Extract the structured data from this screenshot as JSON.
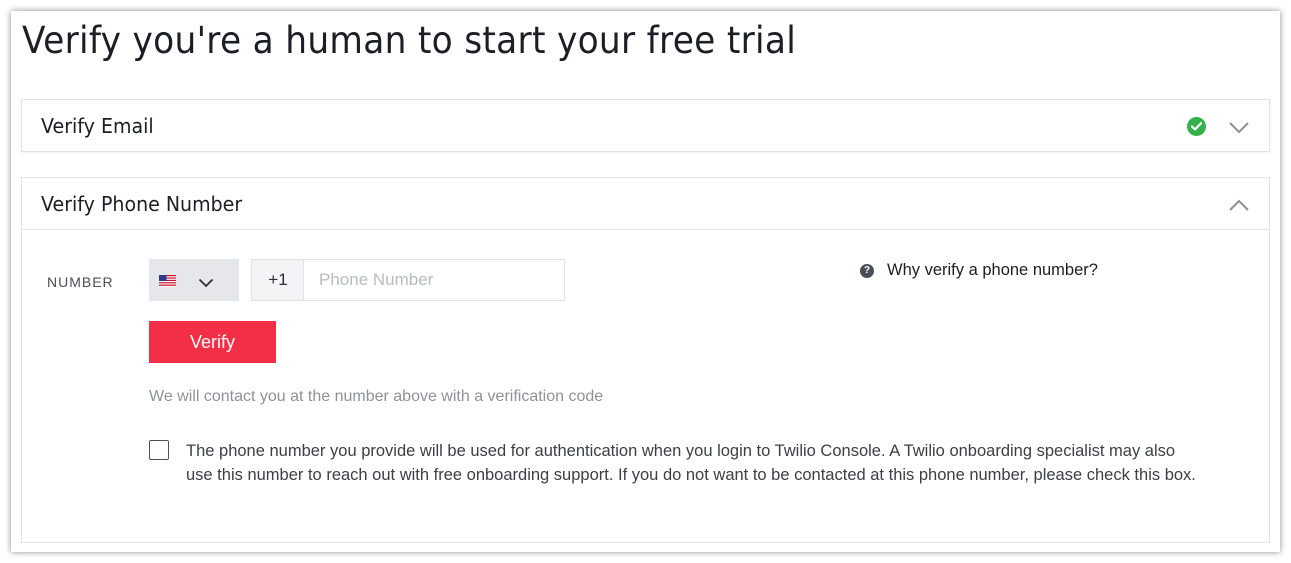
{
  "page": {
    "title": "Verify you're a human to start your free trial"
  },
  "email_section": {
    "title": "Verify Email",
    "status_icon": "check-circle-icon",
    "status_color": "#36b04a",
    "expanded": false
  },
  "phone_section": {
    "title": "Verify Phone Number",
    "expanded": true,
    "number_label": "NUMBER",
    "country": {
      "flag_icon": "us-flag-icon",
      "dial_code": "+1"
    },
    "phone_input": {
      "value": "",
      "placeholder": "Phone Number"
    },
    "verify_button_label": "Verify",
    "verify_button_color": "#f22f46",
    "helper_text": "We will contact you at the number above with a verification code",
    "why_link_text": "Why verify a phone number?",
    "optout": {
      "checked": false,
      "text": "The phone number you provide will be used for authentication when you login to Twilio Console. A Twilio onboarding specialist may also use this number to reach out with free onboarding support. If you do not want to be contacted at this phone number, please check this box."
    }
  }
}
